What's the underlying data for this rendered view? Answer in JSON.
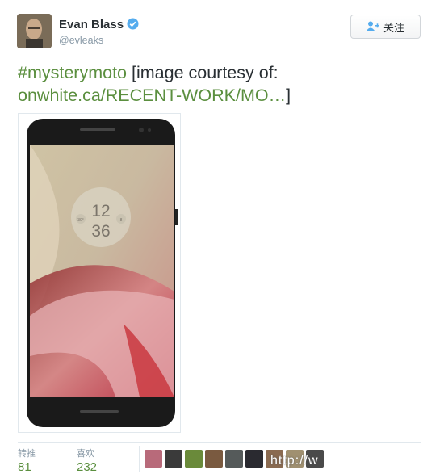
{
  "profile": {
    "name": "Evan Blass",
    "handle": "@evleaks",
    "follow_label": "关注"
  },
  "tweet": {
    "hashtag": "#mysterymoto",
    "text_mid": " [image courtesy of: ",
    "link": "onwhite.ca/RECENT-WORK/MO…",
    "text_end": "]"
  },
  "phone_screen": {
    "hour": "12",
    "minute": "36",
    "left_dial": "30°",
    "right_dial": "8"
  },
  "stats": {
    "retweets_label": "转推",
    "retweets_count": "81",
    "likes_label": "喜欢",
    "likes_count": "232"
  },
  "watermark": "http://w",
  "colors": {
    "link": "#5b8f3f",
    "verified": "#55acee"
  }
}
